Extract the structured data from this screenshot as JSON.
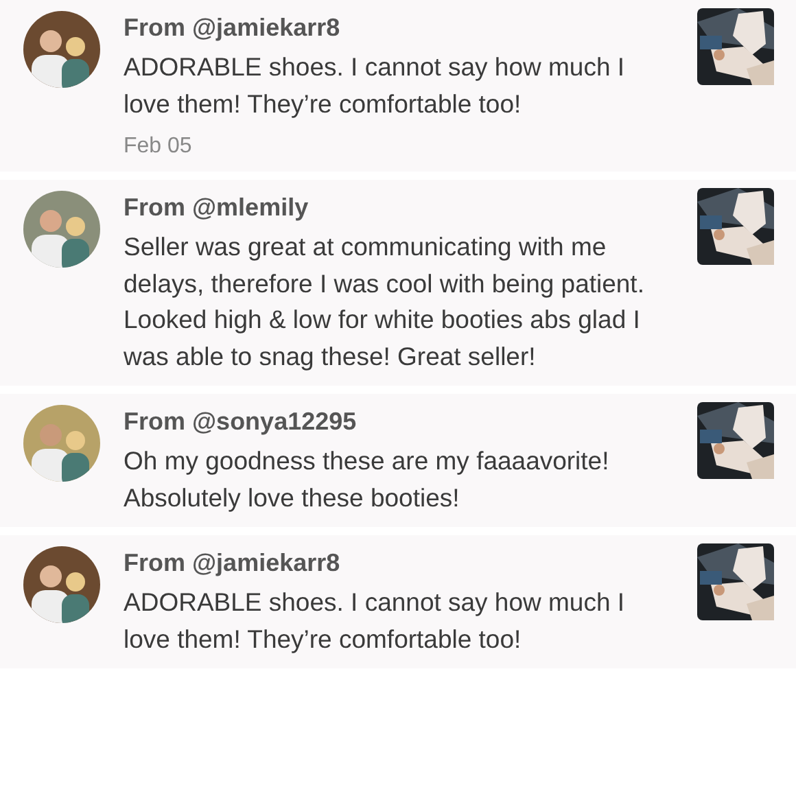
{
  "reviews": [
    {
      "author": "From @jamiekarr8",
      "text": "ADORABLE shoes. I cannot say how much I love them! They’re comfortable too!",
      "date": "Feb 05"
    },
    {
      "author": "From @mlemily",
      "text": "Seller was great at communicating with me delays, therefore I was cool with being patient. Looked high & low for white booties abs glad I was able to snag these! Great seller!"
    },
    {
      "author": "From @sonya12295",
      "text": "Oh my goodness these are my faaaavorite! Absolutely love these booties!"
    },
    {
      "author": "From @jamiekarr8",
      "text": "ADORABLE shoes. I cannot say how much I love them! They’re comfortable too!"
    }
  ]
}
